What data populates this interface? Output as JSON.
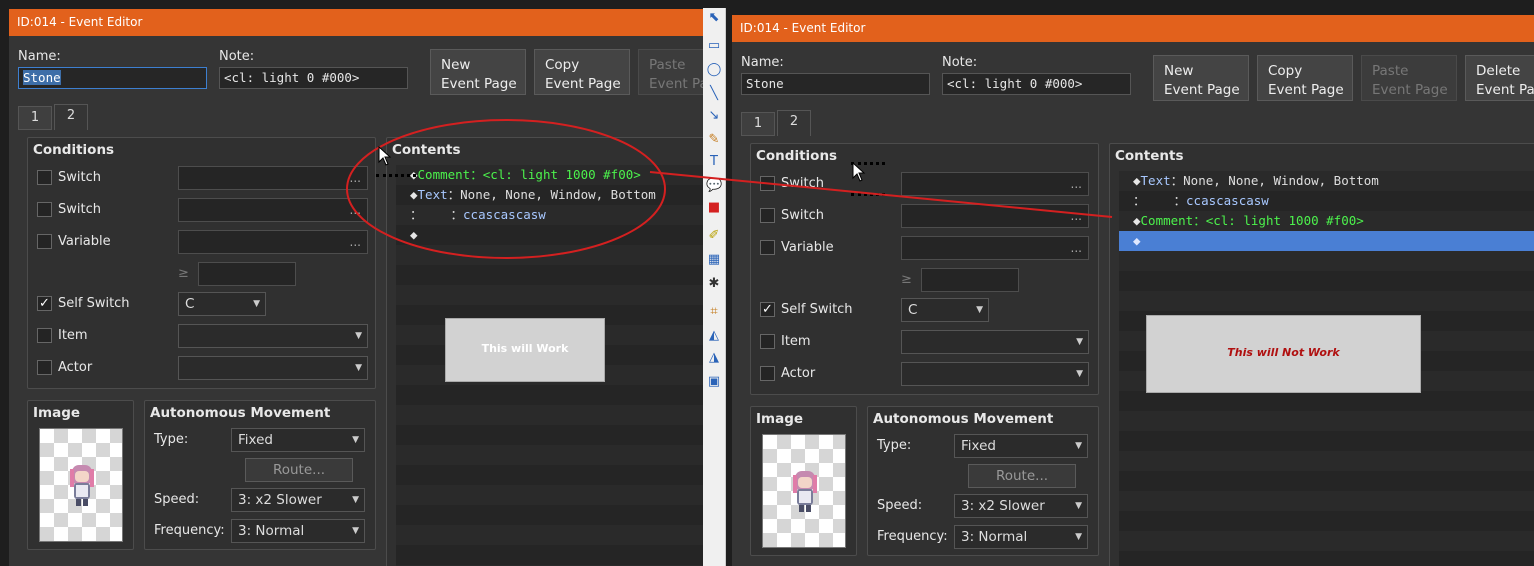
{
  "left_window": {
    "title": "ID:014 - Event Editor",
    "name_label": "Name:",
    "name_value": "Stone",
    "note_label": "Note:",
    "note_value": "<cl: light 0 #000>",
    "buttons": {
      "new_page": "New\nEvent Page",
      "copy_page": "Copy\nEvent Page",
      "paste_page": "Paste\nEvent Pa"
    },
    "tabs": [
      "1",
      "2"
    ],
    "conditions": {
      "title": "Conditions",
      "switch1": "Switch",
      "switch2": "Switch",
      "variable": "Variable",
      "self_switch": "Self Switch",
      "self_switch_value": "C",
      "item": "Item",
      "actor": "Actor",
      "ellipsis": "...",
      "ge": "≥"
    },
    "image_title": "Image",
    "autonomous": {
      "title": "Autonomous Movement",
      "type_label": "Type:",
      "type_value": "Fixed",
      "route": "Route...",
      "speed_label": "Speed:",
      "speed_value": "3: x2 Slower",
      "frequency_label": "Frequency:",
      "frequency_value": "3: Normal"
    },
    "contents": {
      "title": "Contents",
      "lines": [
        {
          "marker": "◆",
          "cmd": "Comment",
          "sep": "：",
          "args": "<cl: light 1000 #f00>"
        },
        {
          "marker": "◆",
          "cmd": "Text",
          "sep": "：",
          "args": "None, None, Window, Bottom"
        },
        {
          "marker": "：",
          "cmd": "",
          "sep": "：",
          "args": "ccascascasw"
        },
        {
          "marker": "◆",
          "cmd": "",
          "sep": "",
          "args": ""
        }
      ]
    },
    "note_box": "This will Work"
  },
  "right_window": {
    "title": "ID:014 - Event Editor",
    "name_label": "Name:",
    "name_value": "Stone",
    "note_label": "Note:",
    "note_value": "<cl: light 0 #000>",
    "buttons": {
      "new_page": "New\nEvent Page",
      "copy_page": "Copy\nEvent Page",
      "paste_page": "Paste\nEvent Page",
      "delete_page": "Delete\nEvent Pa"
    },
    "tabs": [
      "1",
      "2"
    ],
    "conditions": {
      "title": "Conditions",
      "switch1": "Switch",
      "switch2": "Switch",
      "variable": "Variable",
      "self_switch": "Self Switch",
      "self_switch_value": "C",
      "item": "Item",
      "actor": "Actor",
      "ellipsis": "...",
      "ge": "≥"
    },
    "image_title": "Image",
    "autonomous": {
      "title": "Autonomous Movement",
      "type_label": "Type:",
      "type_value": "Fixed",
      "route": "Route...",
      "speed_label": "Speed:",
      "speed_value": "3: x2 Slower",
      "frequency_label": "Frequency:",
      "frequency_value": "3: Normal"
    },
    "contents": {
      "title": "Contents",
      "lines": [
        {
          "marker": "◆",
          "cmd": "Text",
          "sep": "：",
          "args": "None, None, Window, Bottom"
        },
        {
          "marker": "：",
          "cmd": "",
          "sep": "：",
          "args": "ccascascasw"
        },
        {
          "marker": "◆",
          "cmd": "Comment",
          "sep": "：",
          "args": "<cl: light 1000 #f00>"
        },
        {
          "marker": "◆",
          "cmd": "",
          "sep": "",
          "args": ""
        }
      ]
    },
    "note_box": "This will Not Work"
  },
  "colors": {
    "titlebar": "#e2611c",
    "comment_green": "#4cf24c",
    "selected_row": "#4a7fd4",
    "annotation_red": "#d42020"
  },
  "toolbar_icons": [
    "pointer-icon",
    "rectangle-icon",
    "ellipse-icon",
    "line-icon",
    "arrow-icon",
    "pen-icon",
    "text-icon",
    "callout-icon",
    "stamp-icon",
    "highlighter-icon",
    "blur-icon",
    "magic-icon",
    "crop-icon",
    "flip-h-icon",
    "flip-v-icon",
    "frame-icon"
  ]
}
